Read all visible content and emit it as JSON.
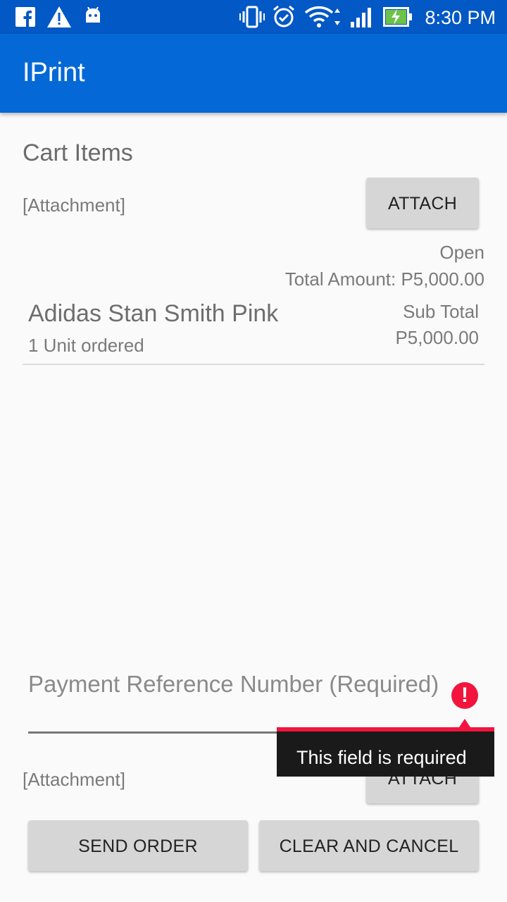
{
  "status_bar": {
    "time": "8:30 PM",
    "icons": [
      "facebook-icon",
      "warning-icon",
      "android-icon",
      "vibrate-icon",
      "alarm-icon",
      "wifi-icon",
      "signal-icon",
      "battery-charging-icon"
    ]
  },
  "app_bar": {
    "title": "IPrint"
  },
  "cart": {
    "title": "Cart Items",
    "attachment_label": "[Attachment]",
    "attach_button": "ATTACH",
    "status": "Open",
    "total_amount": "Total Amount: P5,000.00",
    "items": [
      {
        "name": "Adidas Stan Smith Pink",
        "units": "1 Unit ordered",
        "subtotal_label": "Sub Total",
        "subtotal": "P5,000.00"
      }
    ]
  },
  "payment": {
    "reference_hint": "Payment Reference Number (Required)",
    "error_message": "This field is required",
    "attachment_label": "[Attachment]",
    "attach_button": "ATTACH"
  },
  "actions": {
    "send_order": "SEND ORDER",
    "clear_cancel": "CLEAR AND CANCEL"
  },
  "colors": {
    "status_bar": "#0258c4",
    "app_bar": "#0469d6",
    "error": "#f2143c"
  }
}
